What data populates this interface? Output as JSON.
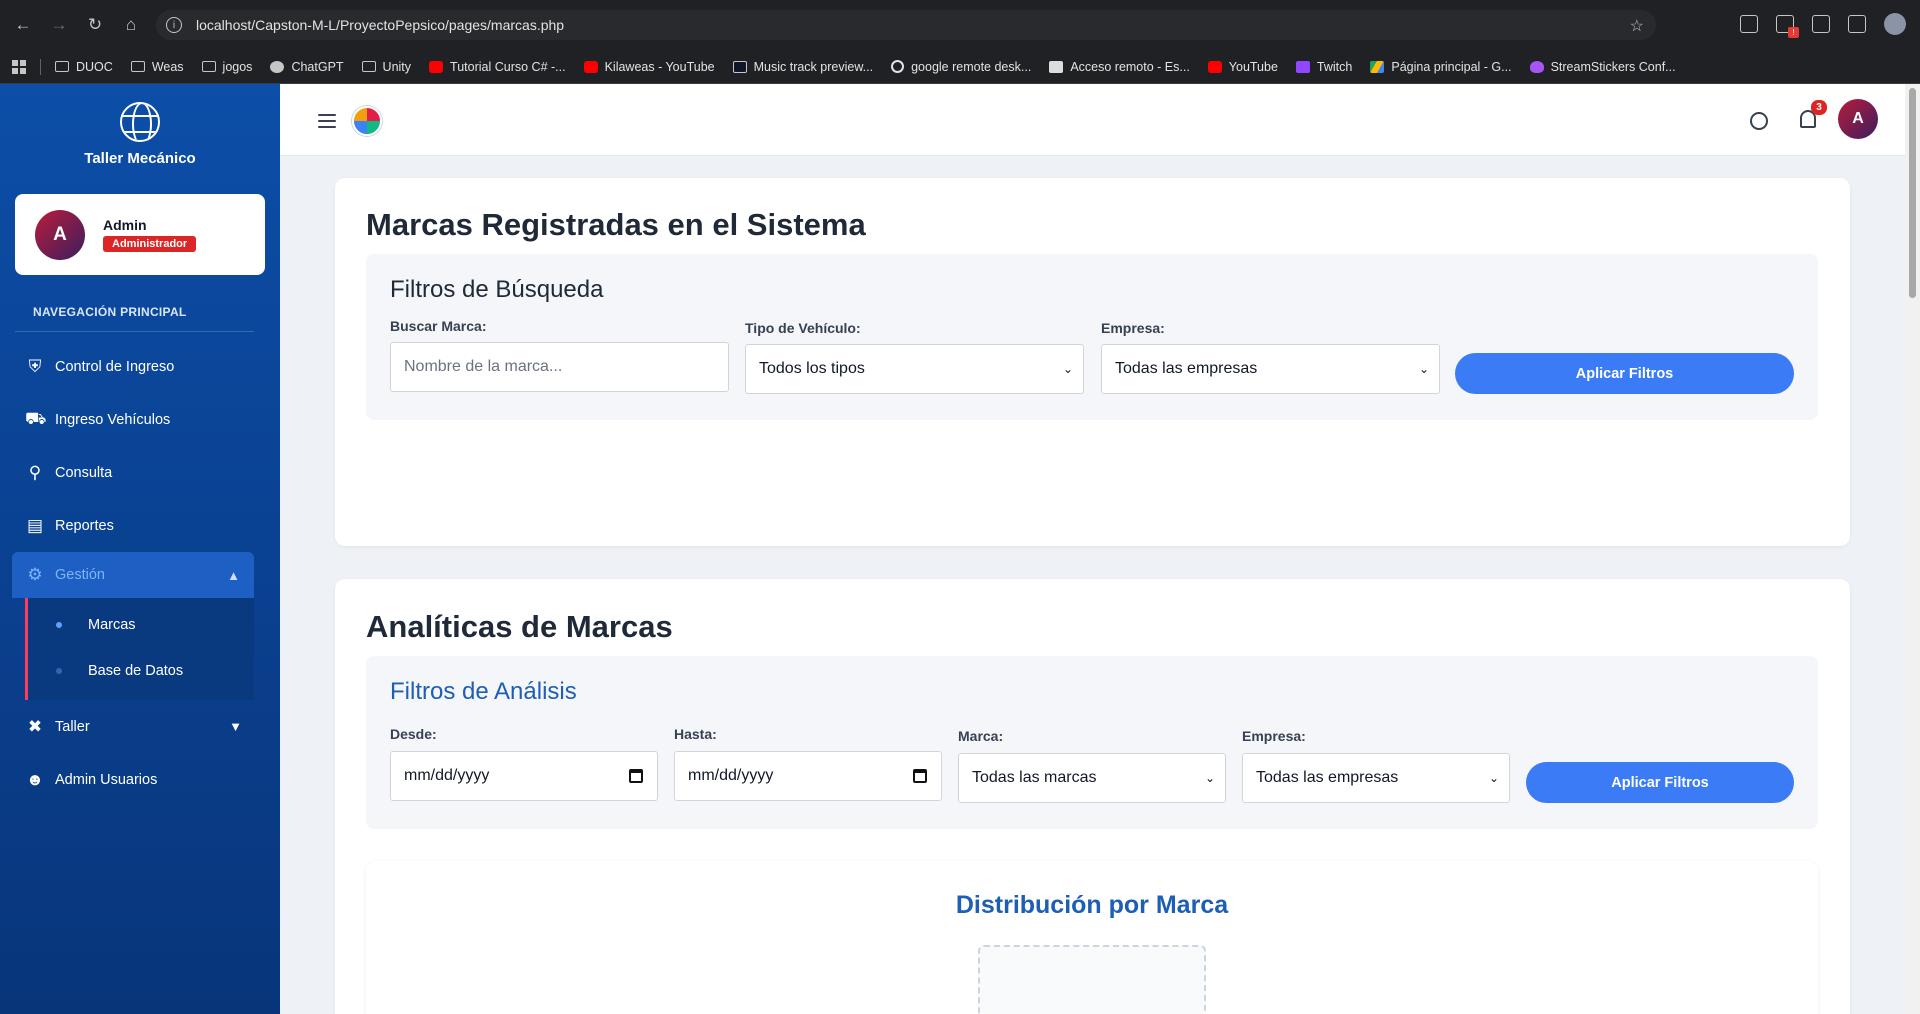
{
  "browser": {
    "url": "localhost/Capston-M-L/ProyectoPepsico/pages/marcas.php",
    "bookmarks": [
      "DUOC",
      "Weas",
      "jogos",
      "ChatGPT",
      "Unity",
      "Tutorial Curso C# -...",
      "Kilaweas - YouTube",
      "Music track preview...",
      "google remote desk...",
      "Acceso remoto - Es...",
      "YouTube",
      "Twitch",
      "Página principal - G...",
      "StreamStickers Conf..."
    ]
  },
  "sidebar": {
    "brand": "Taller Mecánico",
    "user": {
      "initial": "A",
      "name": "Admin",
      "role": "Administrador"
    },
    "section_title": "NAVEGACIÓN PRINCIPAL",
    "items": [
      {
        "label": "Control de Ingreso",
        "icon": "shield-icon"
      },
      {
        "label": "Ingreso Vehículos",
        "icon": "car-icon"
      },
      {
        "label": "Consulta",
        "icon": "search-icon"
      },
      {
        "label": "Reportes",
        "icon": "chart-icon"
      },
      {
        "label": "Gestión",
        "icon": "cogs-icon"
      },
      {
        "label": "Taller",
        "icon": "tools-icon"
      },
      {
        "label": "Admin Usuarios",
        "icon": "users-cog-icon"
      }
    ],
    "submenu": [
      "Marcas",
      "Base de Datos"
    ]
  },
  "topbar": {
    "notification_count": "3",
    "avatar_initial": "A"
  },
  "brands_card": {
    "title": "Marcas Registradas en el Sistema",
    "filters_title": "Filtros de Búsqueda",
    "search_label": "Buscar Marca:",
    "search_placeholder": "Nombre de la marca...",
    "vehicle_type_label": "Tipo de Vehículo:",
    "vehicle_type_value": "Todos los tipos",
    "company_label": "Empresa:",
    "company_value": "Todas las empresas",
    "apply_button": "Aplicar Filtros"
  },
  "analytics_card": {
    "title": "Analíticas de Marcas",
    "filters_title": "Filtros de Análisis",
    "from_label": "Desde:",
    "from_value": "mm/dd/yyyy",
    "to_label": "Hasta:",
    "to_value": "mm/dd/yyyy",
    "brand_label": "Marca:",
    "brand_value": "Todas las marcas",
    "company_label": "Empresa:",
    "company_value": "Todas las empresas",
    "apply_button": "Aplicar Filtros",
    "chart_title": "Distribución por Marca"
  },
  "colors": {
    "sidebar": "#0c4ea8",
    "primary_button": "#3b7bf6",
    "role_badge": "#dc2626",
    "analysis_heading": "#1d5fb5"
  }
}
